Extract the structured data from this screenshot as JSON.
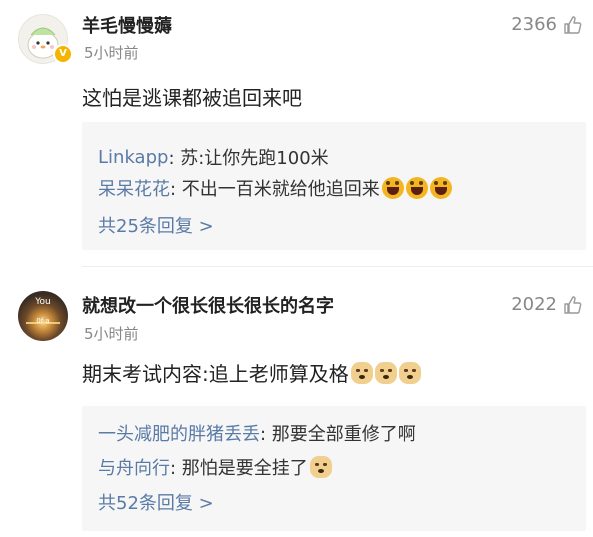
{
  "comments": [
    {
      "username": "羊毛慢慢薅",
      "time": "5小时前",
      "likes": "2366",
      "content": "这怕是逃课都被追回来吧",
      "avatar_badge": "V",
      "replies": [
        {
          "nick": "Linkapp",
          "text": ": 苏:让你先跑100米",
          "emojis": []
        },
        {
          "nick": "呆呆花花",
          "text": ": 不出一百米就给他追回来",
          "emojis": [
            "laugh-emoji",
            "laugh-emoji",
            "laugh-emoji"
          ]
        }
      ],
      "more_replies": "共25条回复 >"
    },
    {
      "username": "就想改一个很长很长很长的名字",
      "time": "5小时前",
      "likes": "2022",
      "content": "期末考试内容:追上老师算及格",
      "content_emojis": [
        "doge-emoji",
        "doge-emoji",
        "doge-emoji"
      ],
      "avatar_text_top": "You",
      "avatar_text_bottom": "0f a",
      "replies": [
        {
          "nick": "一头减肥的胖猪丢丢",
          "text": ": 那要全部重修了啊",
          "emojis": []
        },
        {
          "nick": "与舟向行",
          "text": ": 那怕是要全挂了",
          "emojis": [
            "doge-emoji"
          ]
        }
      ],
      "more_replies": "共52条回复 >"
    }
  ],
  "colors": {
    "nick": "#5a7ba6",
    "muted": "#888888",
    "reply_bg": "#f6f6f6",
    "badge": "#f5b400"
  }
}
